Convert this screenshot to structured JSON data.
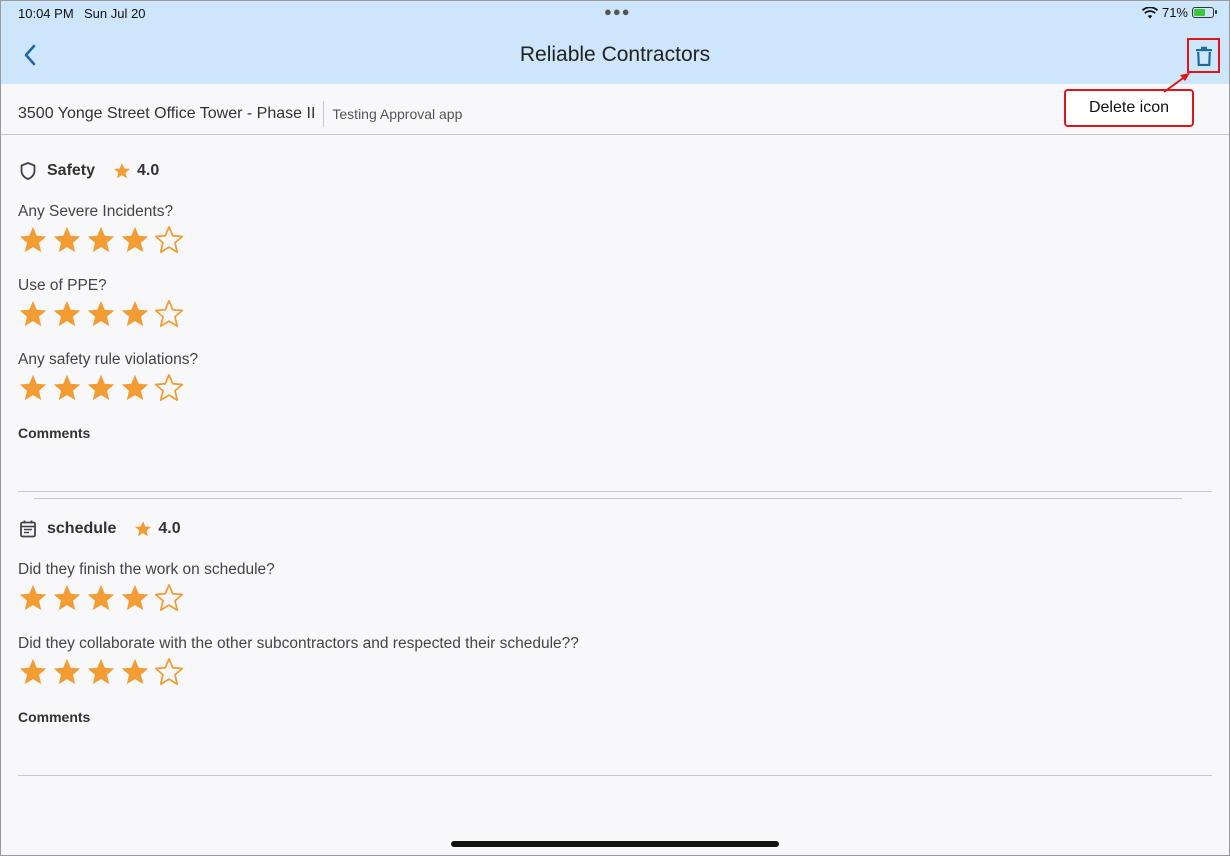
{
  "status_bar": {
    "time": "10:04 PM",
    "date": "Sun Jul 20",
    "battery_percent": "71%",
    "battery_level": 0.71
  },
  "header": {
    "title": "Reliable Contractors"
  },
  "annotation": {
    "callout_text": "Delete icon"
  },
  "project": {
    "name": "3500 Yonge Street Office Tower - Phase II",
    "subtitle": "Testing Approval app"
  },
  "sections": [
    {
      "label": "Safety",
      "rating": "4.0",
      "icon": "shield-icon",
      "questions": [
        {
          "text": "Any Severe Incidents?",
          "stars": 4,
          "max": 5
        },
        {
          "text": "Use of PPE?",
          "stars": 4,
          "max": 5
        },
        {
          "text": "Any safety rule violations?",
          "stars": 4,
          "max": 5
        }
      ],
      "comments_label": "Comments"
    },
    {
      "label": "schedule",
      "rating": "4.0",
      "icon": "calendar-icon",
      "questions": [
        {
          "text": "Did they finish the work on schedule?",
          "stars": 4,
          "max": 5
        },
        {
          "text": "Did they collaborate with the other subcontractors and respected their schedule??",
          "stars": 4,
          "max": 5
        }
      ],
      "comments_label": "Comments"
    }
  ],
  "colors": {
    "header_bg": "#cde6fb",
    "star": "#f39c34",
    "accent": "#1f6a9c",
    "highlight": "#e0141c"
  }
}
